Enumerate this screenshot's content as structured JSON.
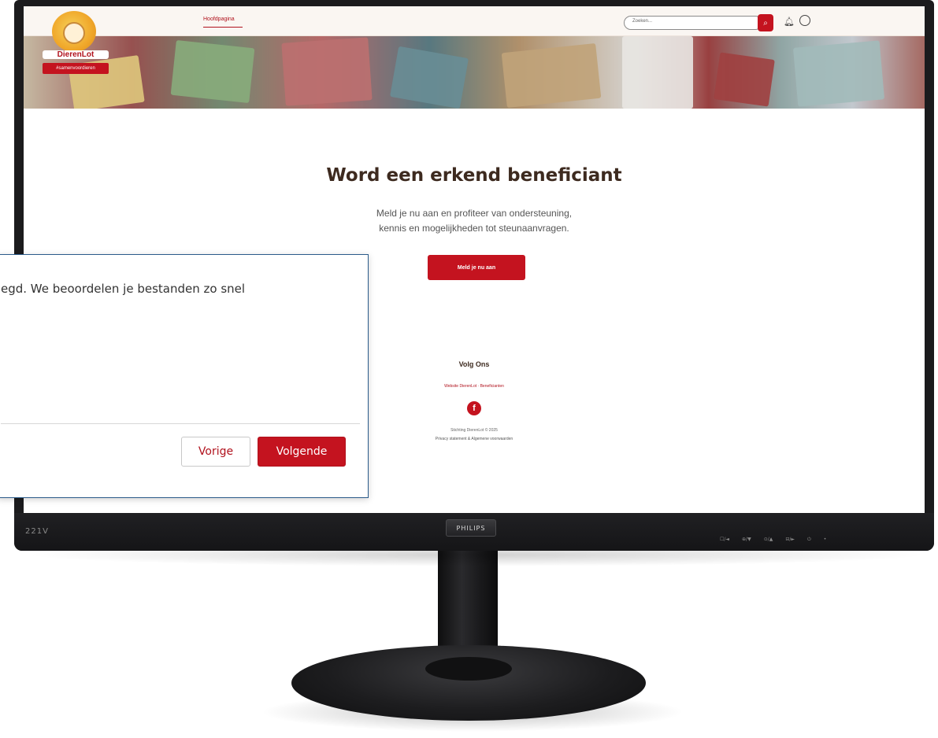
{
  "site": {
    "logo_text": "DierenLot",
    "logo_ribbon": "#samenvoordieren",
    "nav": {
      "home_label": "Hoofdpagina"
    },
    "search": {
      "placeholder": "Zoeken..."
    }
  },
  "hero": {
    "title": "Word een erkend beneficiant",
    "subtitle_line1": "Meld je nu aan en profiteer van ondersteuning,",
    "subtitle_line2": "kennis en mogelijkheden tot steunaanvragen.",
    "cta_label": "Meld je nu aan"
  },
  "footer": {
    "follow_title": "Volg Ons",
    "links": "Website DierenLot · Beneficianten",
    "copyright": "Stichting DierenLot © 2025",
    "legal": "Privacy statement & Algemene voorwaarden"
  },
  "dialog": {
    "message": "egd. We beoordelen je bestanden zo snel",
    "prev_label": "Vorige",
    "next_label": "Volgende"
  },
  "monitor": {
    "model": "221V",
    "brand": "PHILIPS",
    "controls": [
      "☐/◄",
      "⊕/▼",
      "⊙/▲",
      "⊟/►",
      "⏻",
      "•"
    ]
  },
  "colors": {
    "brand_red": "#c4131f",
    "title_brown": "#3d2a1f",
    "dialog_border": "#2b5b8a"
  }
}
